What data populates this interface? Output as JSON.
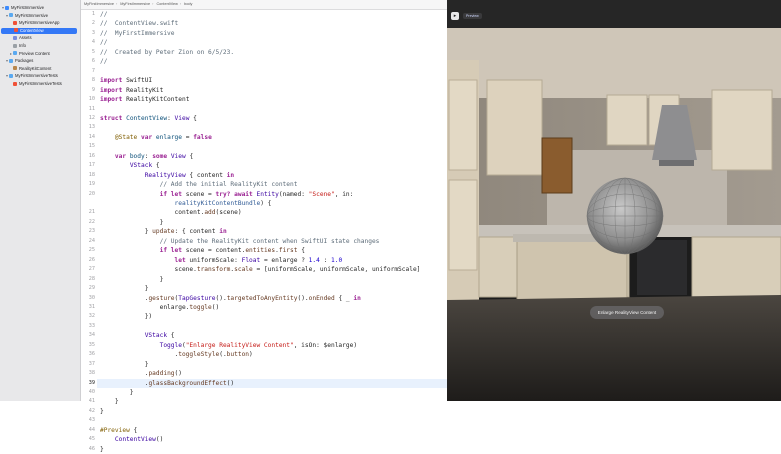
{
  "navigator": {
    "items": [
      {
        "label": "MyFirstImmersive",
        "icon": "app-icon",
        "depth": 0,
        "expanded": true,
        "selected": false
      },
      {
        "label": "MyFirstImmersive",
        "icon": "folder-icon",
        "depth": 1,
        "expanded": true,
        "selected": false
      },
      {
        "label": "MyFirstImmersiveApp",
        "icon": "swift-file-icon",
        "depth": 2,
        "selected": false
      },
      {
        "label": "ContentView",
        "icon": "swift-file-icon",
        "depth": 2,
        "selected": true
      },
      {
        "label": "Assets",
        "icon": "assets-icon",
        "depth": 2,
        "selected": false
      },
      {
        "label": "Info",
        "icon": "plist-icon",
        "depth": 2,
        "selected": false
      },
      {
        "label": "Preview Content",
        "icon": "folder-icon",
        "depth": 2,
        "expanded": false,
        "selected": false
      },
      {
        "label": "Packages",
        "icon": "folder-icon",
        "depth": 1,
        "expanded": true,
        "selected": false
      },
      {
        "label": "RealityKitContent",
        "icon": "package-icon",
        "depth": 2,
        "selected": false
      },
      {
        "label": "MyFirstImmersiveTests",
        "icon": "folder-icon",
        "depth": 1,
        "expanded": true,
        "selected": false
      },
      {
        "label": "MyFirstImmersiveTests",
        "icon": "swift-file-icon",
        "depth": 2,
        "selected": false
      }
    ]
  },
  "jumpbar": {
    "crumbs": [
      "MyFirstImmersive",
      "MyFirstImmersive",
      "ContentView",
      "body"
    ]
  },
  "editor": {
    "current_line": 39,
    "lines": [
      {
        "n": "1",
        "html": "<span class=\"cm\">//</span>"
      },
      {
        "n": "2",
        "html": "<span class=\"cm\">//  ContentView.swift</span>"
      },
      {
        "n": "3",
        "html": "<span class=\"cm\">//  MyFirstImmersive</span>"
      },
      {
        "n": "4",
        "html": "<span class=\"cm\">//</span>"
      },
      {
        "n": "5",
        "html": "<span class=\"cm\">//  Created by Peter Zion on 6/5/23.</span>"
      },
      {
        "n": "6",
        "html": "<span class=\"cm\">//</span>"
      },
      {
        "n": "7",
        "html": ""
      },
      {
        "n": "8",
        "html": "<span class=\"kw\">import</span> SwiftUI"
      },
      {
        "n": "9",
        "html": "<span class=\"kw\">import</span> RealityKit"
      },
      {
        "n": "10",
        "html": "<span class=\"kw\">import</span> RealityKitContent"
      },
      {
        "n": "11",
        "html": ""
      },
      {
        "n": "12",
        "html": "<span class=\"kw\">struct</span> <span class=\"ty\">ContentView</span>: <span class=\"tp\">View</span> {"
      },
      {
        "n": "13",
        "html": ""
      },
      {
        "n": "14",
        "html": "    <span class=\"at\">@State</span> <span class=\"kw\">var</span> <span class=\"ty\">enlarge</span> = <span class=\"kw\">false</span>"
      },
      {
        "n": "15",
        "html": ""
      },
      {
        "n": "16",
        "html": "    <span class=\"kw\">var</span> <span class=\"ty\">body</span>: <span class=\"kw\">some</span> <span class=\"tp\">View</span> {"
      },
      {
        "n": "17",
        "html": "        <span class=\"tp\">VStack</span> {"
      },
      {
        "n": "18",
        "html": "            <span class=\"tp\">RealityView</span> { content <span class=\"kw\">in</span>"
      },
      {
        "n": "19",
        "html": "                <span class=\"cm\">// Add the initial RealityKit content</span>"
      },
      {
        "n": "20",
        "html": "                <span class=\"kw\">if let</span> scene = <span class=\"kw\">try? await</span> <span class=\"tp\">Entity</span>(named: <span class=\"st\">\"Scene\"</span>, in:"
      },
      {
        "n": "",
        "html": "                    <span class=\"ob\">realityKitContentBundle</span>) {"
      },
      {
        "n": "21",
        "html": "                    content.<span class=\"pr\">add</span>(scene)"
      },
      {
        "n": "22",
        "html": "                }"
      },
      {
        "n": "23",
        "html": "            } <span class=\"pr\">update</span>: { content <span class=\"kw\">in</span>"
      },
      {
        "n": "24",
        "html": "                <span class=\"cm\">// Update the RealityKit content when SwiftUI state changes</span>"
      },
      {
        "n": "25",
        "html": "                <span class=\"kw\">if let</span> scene = content.<span class=\"pr\">entities</span>.<span class=\"pr\">first</span> {"
      },
      {
        "n": "26",
        "html": "                    <span class=\"kw\">let</span> uniformScale: <span class=\"tp\">Float</span> = enlarge ? <span class=\"nu\">1.4</span> : <span class=\"nu\">1.0</span>"
      },
      {
        "n": "27",
        "html": "                    scene.<span class=\"pr\">transform</span>.<span class=\"pr\">scale</span> = [uniformScale, uniformScale, uniformScale]"
      },
      {
        "n": "28",
        "html": "                }"
      },
      {
        "n": "29",
        "html": "            }"
      },
      {
        "n": "30",
        "html": "            .<span class=\"pr\">gesture</span>(<span class=\"tp\">TapGesture</span>().<span class=\"pr\">targetedToAnyEntity</span>().<span class=\"pr\">onEnded</span> { _ <span class=\"kw\">in</span>"
      },
      {
        "n": "31",
        "html": "                enlarge.<span class=\"pr\">toggle</span>()"
      },
      {
        "n": "32",
        "html": "            })"
      },
      {
        "n": "33",
        "html": ""
      },
      {
        "n": "34",
        "html": "            <span class=\"tp\">VStack</span> {"
      },
      {
        "n": "35",
        "html": "                <span class=\"tp\">Toggle</span>(<span class=\"st\">\"Enlarge RealityView Content\"</span>, isOn: $enlarge)"
      },
      {
        "n": "36",
        "html": "                    .<span class=\"pr\">toggleStyle</span>(.<span class=\"pr\">button</span>)"
      },
      {
        "n": "37",
        "html": "            }"
      },
      {
        "n": "38",
        "html": "            .<span class=\"pr\">padding</span>()"
      },
      {
        "n": "39",
        "html": "            .<span class=\"pr\">glassBackgroundEffect</span>()"
      },
      {
        "n": "40",
        "html": "        }"
      },
      {
        "n": "41",
        "html": "    }"
      },
      {
        "n": "42",
        "html": "}"
      },
      {
        "n": "43",
        "html": ""
      },
      {
        "n": "44",
        "html": "<span class=\"at\">#Preview</span> {"
      },
      {
        "n": "45",
        "html": "    <span class=\"tp\">ContentView</span>()"
      },
      {
        "n": "46",
        "html": "}"
      }
    ]
  },
  "preview": {
    "preview_button_label": "Preview",
    "enlarge_button_label": "Enlarge RealityView Content"
  }
}
